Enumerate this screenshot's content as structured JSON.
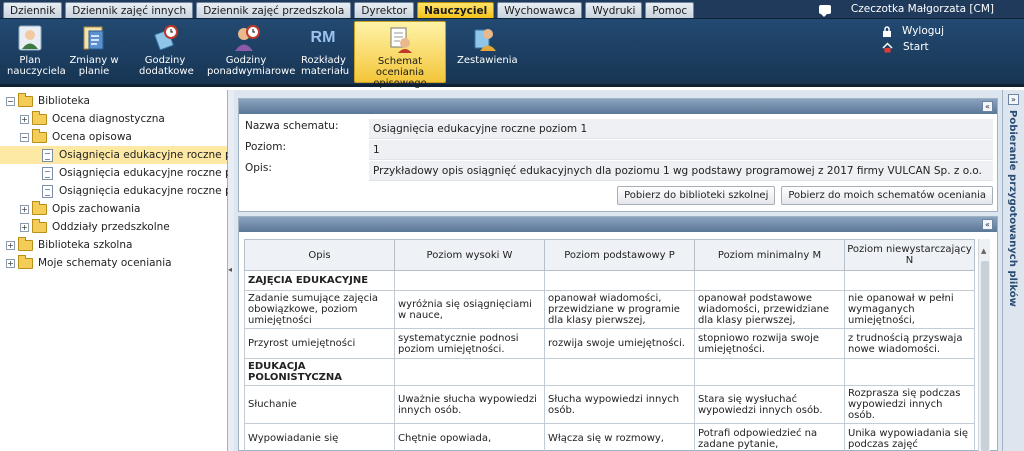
{
  "tabs": [
    {
      "label": "Dziennik",
      "active": false
    },
    {
      "label": "Dziennik zajęć innych",
      "active": false
    },
    {
      "label": "Dziennik zajęć przedszkola",
      "active": false
    },
    {
      "label": "Dyrektor",
      "active": false
    },
    {
      "label": "Nauczyciel",
      "active": true
    },
    {
      "label": "Wychowawca",
      "active": false
    },
    {
      "label": "Wydruki",
      "active": false
    },
    {
      "label": "Pomoc",
      "active": false
    }
  ],
  "user": {
    "name": "Czeczotka Małgorzata [CM]"
  },
  "ribbon": {
    "buttons": [
      {
        "line1": "Plan",
        "line2": "nauczyciela",
        "icon": "teacher-plan-icon"
      },
      {
        "line1": "Zmiany w",
        "line2": "planie",
        "icon": "plan-changes-icon"
      },
      {
        "line1": "Godziny",
        "line2": "dodatkowe",
        "icon": "additional-hours-icon"
      },
      {
        "line1": "Godziny",
        "line2": "ponadwymiarowe",
        "icon": "overtime-hours-icon"
      },
      {
        "line1": "Rozkłady",
        "line2": "materiału",
        "icon": "rm-icon"
      },
      {
        "line1": "Schemat oceniania",
        "line2": "opisowego",
        "icon": "descriptive-schema-icon"
      },
      {
        "line1": "Zestawienia",
        "line2": "",
        "icon": "summary-icon"
      }
    ],
    "rm_text": "RM",
    "logout": "Wyloguj",
    "start": "Start"
  },
  "tree": {
    "root": "Biblioteka",
    "diag": "Ocena diagnostyczna",
    "opis": "Ocena opisowa",
    "items": [
      "Osiągnięcia edukacyjne roczne po...",
      "Osiągnięcia edukacyjne roczne po...",
      "Osiągnięcia edukacyjne roczne po..."
    ],
    "zach": "Opis zachowania",
    "przed": "Oddziały przedszkolne",
    "szk": "Biblioteka szkolna",
    "moje": "Moje schematy oceniania"
  },
  "details": {
    "name_label": "Nazwa schematu:",
    "name_value": "Osiągnięcia edukacyjne roczne poziom 1",
    "level_label": "Poziom:",
    "level_value": "1",
    "desc_label": "Opis:",
    "desc_value": "Przykładowy opis osiągnięć edukacyjnych dla poziomu 1 wg podstawy programowej z 2017 firmy VULCAN Sp. z o.o.",
    "btn_school": "Pobierz do biblioteki szkolnej",
    "btn_mine": "Pobierz do moich schematów oceniania"
  },
  "grid": {
    "headers": [
      "Opis",
      "Poziom wysoki W",
      "Poziom podstawowy P",
      "Poziom minimalny M",
      "Poziom niewystarczający N"
    ],
    "cat1": "ZAJĘCIA EDUKACYJNE",
    "cat2": "EDUKACJA POLONISTYCZNA",
    "rows": [
      [
        "Zadanie sumujące zajęcia obowiązkowe, poziom umiejętności",
        "wyróżnia się osiągnięciami w nauce,",
        "opanował wiadomości, przewidziane w programie dla klasy pierwszej,",
        "opanował podstawowe wiadomości, przewidziane dla klasy pierwszej,",
        "nie opanował w pełni wymaganych umiejętności,"
      ],
      [
        "Przyrost umiejętności",
        "systematycznie podnosi poziom umiejętności.",
        "rozwija swoje umiejętności.",
        "stopniowo rozwija swoje umiejętności.",
        "z trudnością przyswaja nowe wiadomości."
      ],
      [
        "Słuchanie",
        "Uważnie słucha wypowiedzi innych osób.",
        "Słucha wypowiedzi innych osób.",
        "Stara się wysłuchać wypowiedzi innych osób.",
        "Rozprasza się podczas wypowiedzi innych osób."
      ],
      [
        "Wypowiadanie się",
        "Chętnie opowiada,",
        "Włącza się w rozmowy,",
        "Potrafi odpowiedzieć na zadane pytanie,",
        "Unika wypowiadania się podczas zajęć"
      ]
    ]
  },
  "side_panel": {
    "title": "Pobieranie przygotowanych plików"
  }
}
